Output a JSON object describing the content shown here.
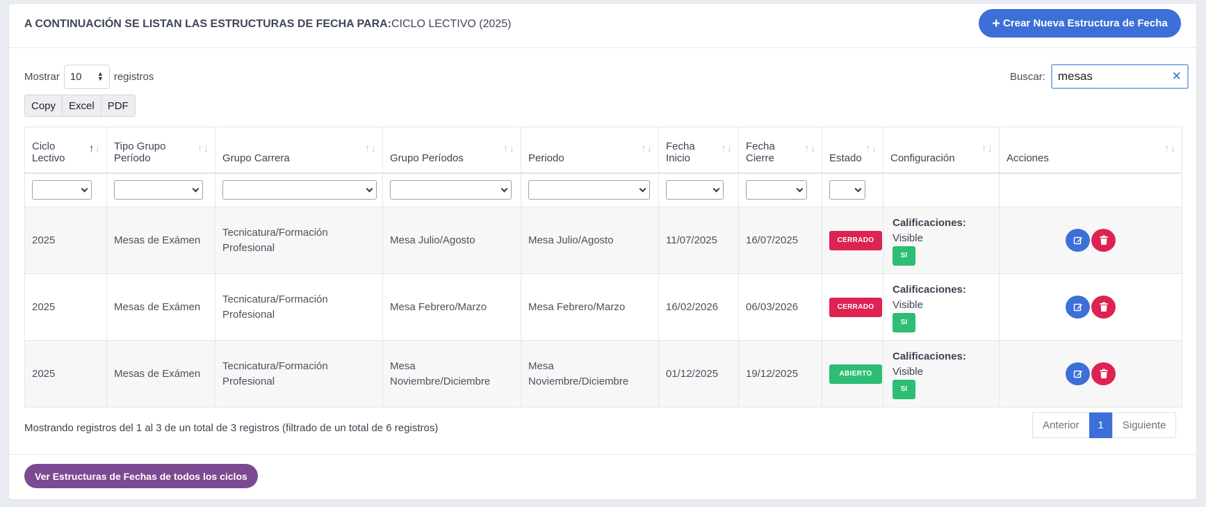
{
  "header": {
    "title_label": "A CONTINUACIÓN SE LISTAN LAS ESTRUCTURAS DE FECHA PARA:",
    "title_value": "CICLO LECTIVO (2025)",
    "create_button": "Crear Nueva Estructura de Fecha"
  },
  "length": {
    "prefix": "Mostrar",
    "value": "10",
    "suffix": "registros"
  },
  "search": {
    "label": "Buscar:",
    "value": "mesas"
  },
  "export": [
    "Copy",
    "Excel",
    "PDF"
  ],
  "columns": [
    {
      "label": "Ciclo Lectivo",
      "sorted": "asc"
    },
    {
      "label": "Tipo Grupo Período",
      "sorted": "none"
    },
    {
      "label": "Grupo Carrera",
      "sorted": "none"
    },
    {
      "label": "Grupo Períodos",
      "sorted": "none"
    },
    {
      "label": "Periodo",
      "sorted": "none"
    },
    {
      "label": "Fecha Inicio",
      "sorted": "none"
    },
    {
      "label": "Fecha Cierre",
      "sorted": "none"
    },
    {
      "label": "Estado",
      "sorted": "none"
    },
    {
      "label": "Configuración",
      "sorted": "none"
    },
    {
      "label": "Acciones",
      "sorted": "none"
    }
  ],
  "rows": [
    {
      "ciclo": "2025",
      "tipo": "Mesas de Exámen",
      "carrera": "Tecnicatura/Formación Profesional",
      "grupo_periodos": "Mesa Julio/Agosto",
      "periodo": "Mesa Julio/Agosto",
      "inicio": "11/07/2025",
      "cierre": "16/07/2025",
      "estado": "CERRADO",
      "config_title": "Calificaciones:",
      "config_sub": "Visible",
      "config_badge": "SI"
    },
    {
      "ciclo": "2025",
      "tipo": "Mesas de Exámen",
      "carrera": "Tecnicatura/Formación Profesional",
      "grupo_periodos": "Mesa Febrero/Marzo",
      "periodo": "Mesa Febrero/Marzo",
      "inicio": "16/02/2026",
      "cierre": "06/03/2026",
      "estado": "CERRADO",
      "config_title": "Calificaciones:",
      "config_sub": "Visible",
      "config_badge": "SI"
    },
    {
      "ciclo": "2025",
      "tipo": "Mesas de Exámen",
      "carrera": "Tecnicatura/Formación Profesional",
      "grupo_periodos": "Mesa Noviembre/Diciembre",
      "periodo": "Mesa Noviembre/Diciembre",
      "inicio": "01/12/2025",
      "cierre": "19/12/2025",
      "estado": "ABIERTO",
      "config_title": "Calificaciones:",
      "config_sub": "Visible",
      "config_badge": "SI"
    }
  ],
  "info": "Mostrando registros del 1 al 3 de un total de 3 registros (filtrado de un total de 6 registros)",
  "pagination": {
    "prev": "Anterior",
    "current": "1",
    "next": "Siguiente"
  },
  "footer": {
    "all_cycles_button": "Ver Estructuras de Fechas de todos los ciclos"
  },
  "icons": {
    "edit": "edit-icon",
    "delete": "trash-icon",
    "clear": "close-icon",
    "create": "plus-icon"
  },
  "colors": {
    "primary": "#3c6fd8",
    "danger": "#dc2351",
    "success": "#2dbd74",
    "purple": "#7b4a90",
    "cerrado": "#dc2351",
    "abierto": "#2dbd74"
  }
}
